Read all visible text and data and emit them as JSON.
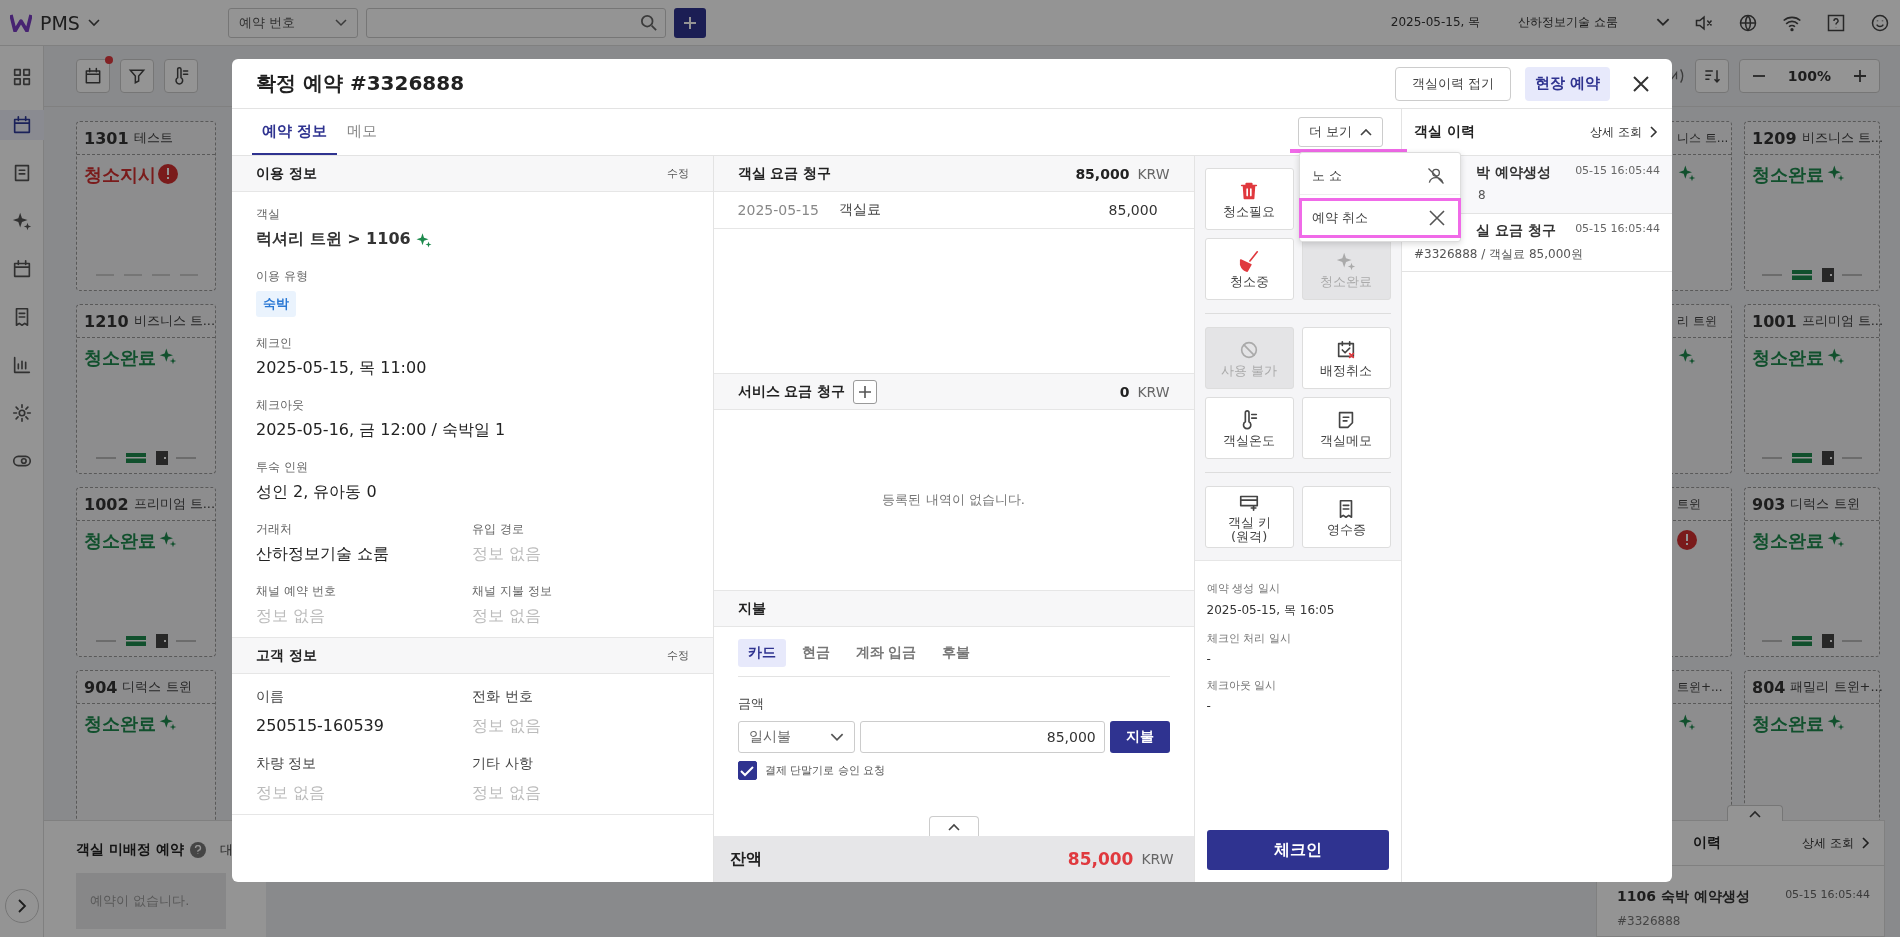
{
  "top_bar": {
    "app_name": "PMS",
    "search_type": "예약 번호",
    "date": "2025-05-15, 목",
    "property": "산하정보기술 쇼룸"
  },
  "toolbar": {
    "zoom": "100%"
  },
  "room_cards": {
    "left": [
      {
        "number": "1301",
        "type": "테스트",
        "status": "청소지시",
        "kind": "alert",
        "has_key": false
      },
      {
        "number": "1210",
        "type": "비즈니스 트...",
        "status": "청소완료",
        "kind": "clean",
        "has_key": true
      },
      {
        "number": "1002",
        "type": "프리미엄 트...",
        "status": "청소완료",
        "kind": "clean",
        "has_key": true
      },
      {
        "number": "904",
        "type": "디럭스 트윈",
        "status": "청소완료",
        "kind": "clean"
      }
    ],
    "partial": [
      {
        "type": "니스 트...",
        "kind": "clean"
      },
      {
        "type": "리 트윈",
        "kind": "clean"
      },
      {
        "type": "트윈",
        "kind": "alert"
      },
      {
        "type": "트윈+...",
        "kind": "clean"
      }
    ],
    "right": [
      {
        "number": "1209",
        "type": "비즈니스 트...",
        "status": "청소완료",
        "kind": "clean",
        "has_key": true
      },
      {
        "number": "1001",
        "type": "프리미엄 트...",
        "status": "청소완료",
        "kind": "clean",
        "has_key": true
      },
      {
        "number": "903",
        "type": "디럭스 트윈",
        "status": "청소완료",
        "kind": "clean",
        "has_key": true
      },
      {
        "number": "804",
        "type": "패밀리 트윈+...",
        "status": "청소완료",
        "kind": "clean"
      }
    ]
  },
  "unassigned": {
    "title": "객실 미배정 예약",
    "tab": "대",
    "empty": "예약이 없습니다."
  },
  "bottom_history": {
    "title": "이력",
    "detail": "상세 조회",
    "items": [
      {
        "title": "1106 숙박 예약생성",
        "time": "05-15 16:05:44",
        "subtitle": "#3326888"
      }
    ]
  },
  "modal": {
    "title": "확정 예약 #3326888",
    "collapse_history": "객실이력 접기",
    "walk_in": "현장 예약",
    "tabs": [
      {
        "label": "예약 정보",
        "selected": true
      },
      {
        "label": "메모",
        "selected": false
      }
    ],
    "more": {
      "label": "더 보기",
      "expanded": true,
      "highlighted": true
    },
    "more_menu": [
      {
        "label": "노 쇼",
        "highlighted": false
      },
      {
        "label": "예약 취소",
        "highlighted": true
      }
    ],
    "stay_info": {
      "title": "이용 정보",
      "edit": "수정",
      "fields": [
        {
          "kind": "room",
          "label": "객실",
          "value": "럭셔리 트윈 > 1106",
          "empty": false
        },
        {
          "kind": "tag",
          "label": "이용 유형",
          "value": "숙박",
          "empty": false
        },
        {
          "kind": "full",
          "label": "체크인",
          "value": "2025-05-15, 목 11:00",
          "empty": false
        },
        {
          "kind": "full",
          "label": "체크아웃",
          "value": "2025-05-16, 금 12:00 / 숙박일 1",
          "empty": false
        },
        {
          "kind": "full",
          "label": "투숙 인원",
          "value": "성인 2, 유아동 0",
          "empty": false
        },
        {
          "kind": "half",
          "label": "거래처",
          "value": "산하정보기술 쇼룸",
          "empty": false
        },
        {
          "kind": "half",
          "label": "유입 경로",
          "value": "정보 없음",
          "empty": true
        },
        {
          "kind": "half",
          "label": "채널 예약 번호",
          "value": "정보 없음",
          "empty": true
        },
        {
          "kind": "half",
          "label": "채널 지불 정보",
          "value": "정보 없음",
          "empty": true
        }
      ]
    },
    "guest_info": {
      "title": "고객 정보",
      "edit": "수정",
      "fields": [
        {
          "label": "이름",
          "value": "250515-160539",
          "empty": false
        },
        {
          "label": "전화 번호",
          "value": "정보 없음",
          "empty": true
        },
        {
          "label": "차량 정보",
          "value": "정보 없음",
          "empty": true
        },
        {
          "label": "기타 사항",
          "value": "정보 없음",
          "empty": true
        }
      ]
    },
    "room_charges": {
      "title": "객실 요금 청구",
      "total": "85,000",
      "currency": "KRW",
      "rows": [
        {
          "date": "2025-05-15",
          "item": "객실료",
          "amount": "85,000"
        }
      ]
    },
    "service_charges": {
      "title": "서비스 요금 청구",
      "total": "0",
      "currency": "KRW",
      "empty": "등록된 내역이 없습니다."
    },
    "payment": {
      "title": "지불",
      "methods": [
        {
          "label": "카드",
          "selected": true
        },
        {
          "label": "현금",
          "selected": false
        },
        {
          "label": "계좌 입금",
          "selected": false
        },
        {
          "label": "후불",
          "selected": false
        }
      ],
      "amount_label": "금액",
      "installment": "일시불",
      "amount": "85,000",
      "pay": "지불",
      "terminal": {
        "label": "결제 단말기로 승인 요청",
        "checked": true
      }
    },
    "balance": {
      "label": "잔액",
      "amount": "85,000",
      "currency": "KRW"
    },
    "actions": {
      "groups": [
        {
          "buttons": [
            {
              "label": "청소필요",
              "disabled": false
            },
            {
              "label": "청소중",
              "disabled": false
            },
            {
              "label": "청소완료",
              "disabled": true
            }
          ]
        },
        {
          "buttons": [
            {
              "label": "사용 불가",
              "disabled": true
            },
            {
              "label": "배정취소",
              "disabled": false
            },
            {
              "label": "객실온도",
              "disabled": false
            },
            {
              "label": "객실메모",
              "disabled": false
            }
          ]
        },
        {
          "buttons": [
            {
              "label": "객실 키\n(원격)",
              "disabled": false
            },
            {
              "label": "영수증",
              "disabled": false
            }
          ]
        }
      ]
    },
    "timestamps": [
      {
        "label": "예약 생성 일시",
        "value": "2025-05-15, 목 16:05"
      },
      {
        "label": "체크인 처리 일시",
        "value": "-"
      },
      {
        "label": "체크아웃 일시",
        "value": "-"
      }
    ],
    "checkin": "체크인",
    "history": {
      "title": "객실 이력",
      "detail": "상세 조회",
      "items": [
        {
          "title": "박 예약생성",
          "subtitle": "8",
          "time": "05-15 16:05:44"
        },
        {
          "title": "실 요금 청구",
          "subtitle": "#3326888 / 객실료 85,000원",
          "time": "05-15 16:05:44"
        }
      ]
    }
  }
}
